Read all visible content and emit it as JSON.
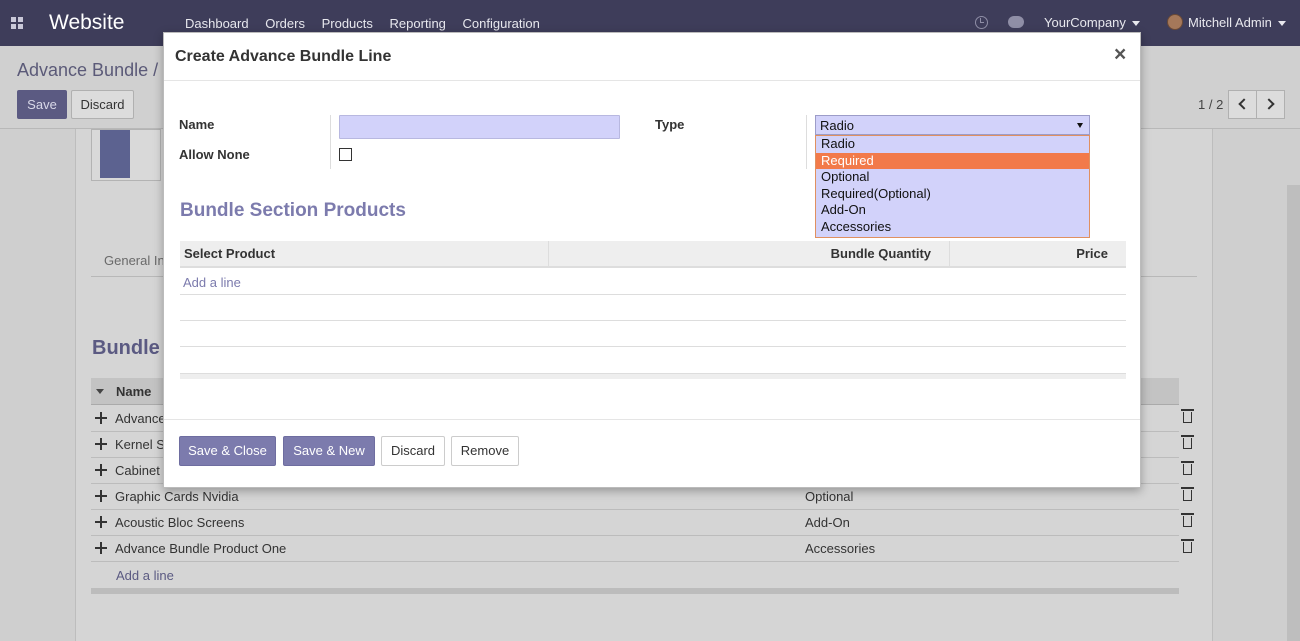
{
  "navbar": {
    "app_title": "Website",
    "menu": [
      "Dashboard",
      "Orders",
      "Products",
      "Reporting",
      "Configuration"
    ],
    "company": "YourCompany",
    "user": "Mitchell Admin"
  },
  "control_panel": {
    "breadcrumb": "Advance Bundle /",
    "save_label": "Save",
    "discard_label": "Discard",
    "pager": "1 / 2"
  },
  "background": {
    "tab_label": "General In",
    "section_heading": "Bundle",
    "column_name": "Name",
    "rows": [
      {
        "name": "Advance",
        "type": ""
      },
      {
        "name": "Kernel S",
        "type": ""
      },
      {
        "name": "Cabinet",
        "type": ""
      },
      {
        "name": "Graphic Cards Nvidia",
        "type": "Optional"
      },
      {
        "name": "Acoustic Bloc Screens",
        "type": "Add-On"
      },
      {
        "name": "Advance Bundle Product One",
        "type": "Accessories"
      }
    ],
    "add_line": "Add a line"
  },
  "dialog": {
    "title": "Create Advance Bundle Line",
    "close_symbol": "×",
    "name_label": "Name",
    "name_value": "",
    "allow_none_label": "Allow None",
    "allow_none_checked": false,
    "type_label": "Type",
    "type_selected": "Radio",
    "type_options": [
      "Radio",
      "Required",
      "Optional",
      "Required(Optional)",
      "Add-On",
      "Accessories"
    ],
    "type_highlighted": "Required",
    "section_title": "Bundle Section Products",
    "table": {
      "columns": [
        "Select Product",
        "Bundle Quantity",
        "Price"
      ],
      "add_line": "Add a line"
    },
    "buttons": {
      "save_close": "Save & Close",
      "save_new": "Save & New",
      "discard": "Discard",
      "remove": "Remove"
    }
  },
  "colors": {
    "navbar": "#3e3d5a",
    "primary": "#7c7bad",
    "highlight": "#f27a4a",
    "input_bg": "#d2d2fa"
  }
}
